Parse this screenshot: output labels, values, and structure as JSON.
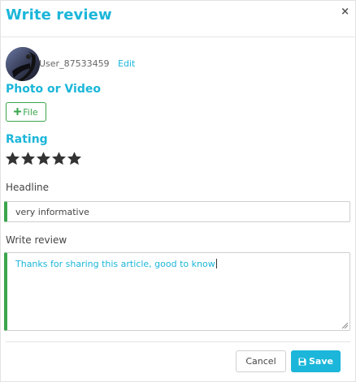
{
  "modal": {
    "title": "Write review",
    "close_label": "×"
  },
  "user": {
    "username": "User_87533459",
    "edit_label": "Edit"
  },
  "media": {
    "label": "Photo or Video",
    "file_button_label": "File",
    "file_button_icon": "plus-icon"
  },
  "rating": {
    "label": "Rating",
    "value": 5,
    "max": 5,
    "star_color": "#333333"
  },
  "headline": {
    "label": "Headline",
    "value": "very informative"
  },
  "review": {
    "label": "Write review",
    "value": "Thanks for sharing this article, good to know"
  },
  "footer": {
    "cancel_label": "Cancel",
    "save_label": "Save",
    "save_icon": "floppy-disk-icon"
  },
  "colors": {
    "accent": "#1bb6d9",
    "success": "#3aa64c"
  }
}
